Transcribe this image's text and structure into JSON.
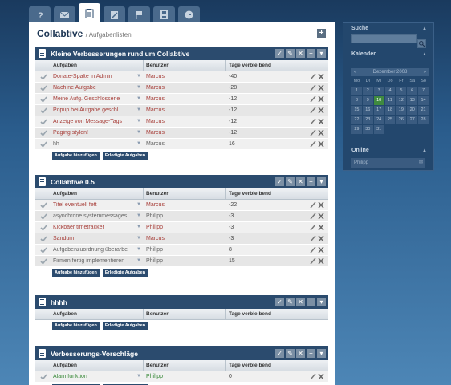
{
  "nav": {
    "tabs": [
      {
        "name": "help-tab",
        "icon": "question-icon"
      },
      {
        "name": "mail-tab",
        "icon": "envelope-icon"
      },
      {
        "name": "tasks-tab",
        "icon": "clipboard-icon",
        "active": true
      },
      {
        "name": "edit-tab",
        "icon": "pencil-icon"
      },
      {
        "name": "flag-tab",
        "icon": "flag-icon"
      },
      {
        "name": "files-tab",
        "icon": "disk-icon"
      },
      {
        "name": "clock-tab",
        "icon": "clock-icon"
      }
    ]
  },
  "page": {
    "title": "Collabtive",
    "subtitle": "/ Aufgabenlisten"
  },
  "columns": {
    "task": "Aufgaben",
    "user": "Benutzer",
    "days": "Tage verbleibend"
  },
  "buttons": {
    "add_task": "Aufgabe hinzufügen",
    "done_tasks": "Erledigte Aufgaben"
  },
  "lists": [
    {
      "title": "Kleine Verbesserungen rund um Collabtive",
      "rows": [
        {
          "task": "Donate-Spalte in Admin",
          "user": "Marcus",
          "days": "-40",
          "color": "red"
        },
        {
          "task": "Nach ne Aufgabe",
          "user": "Marcus",
          "days": "-28",
          "color": "red"
        },
        {
          "task": "Meine Aufg. Geschlossene",
          "user": "Marcus",
          "days": "-12",
          "color": "red"
        },
        {
          "task": "Popup bei Aufgabe geschl",
          "user": "Marcus",
          "days": "-12",
          "color": "red"
        },
        {
          "task": "Anzeige von Message-Tags",
          "user": "Marcus",
          "days": "-12",
          "color": "red"
        },
        {
          "task": "Paging stylen!",
          "user": "Marcus",
          "days": "-12",
          "color": "red"
        },
        {
          "task": "hh",
          "user": "Marcus",
          "days": "16",
          "color": "gray"
        }
      ]
    },
    {
      "title": "Collabtive 0.5",
      "rows": [
        {
          "task": "Titel eventuell fett",
          "user": "Marcus",
          "days": "-22",
          "color": "red"
        },
        {
          "task": "asynchrone systemmessages",
          "user": "Philipp",
          "days": "-3",
          "color": "gray"
        },
        {
          "task": "Kickbaer timetracker",
          "user": "Philipp",
          "days": "-3",
          "color": "red"
        },
        {
          "task": "Sandum",
          "user": "Marcus",
          "days": "-3",
          "color": "red"
        },
        {
          "task": "Aufgabenzuordnung überarbe",
          "user": "Philipp",
          "days": "8",
          "color": "gray"
        },
        {
          "task": "Firmen fertig implementieren",
          "user": "Philipp",
          "days": "15",
          "color": "gray"
        }
      ]
    },
    {
      "title": "hhhh",
      "rows": []
    },
    {
      "title": "Verbesserungs-Vorschläge",
      "rows": [
        {
          "task": "Alarmfunktion",
          "user": "Philipp",
          "days": "0",
          "color": "green"
        }
      ]
    }
  ],
  "sidebar": {
    "search_title": "Suche",
    "calendar_title": "Kalender",
    "calendar_month": "Dezember 2008",
    "weekdays": [
      "Mo",
      "Di",
      "Mi",
      "Do",
      "Fr",
      "Sa",
      "So"
    ],
    "days": [
      "1",
      "2",
      "3",
      "4",
      "5",
      "6",
      "7",
      "8",
      "9",
      "10",
      "11",
      "12",
      "13",
      "14",
      "15",
      "16",
      "17",
      "18",
      "19",
      "20",
      "21",
      "22",
      "23",
      "24",
      "25",
      "26",
      "27",
      "28",
      "29",
      "30",
      "31"
    ],
    "today": "10",
    "online_title": "Online",
    "online_users": [
      "Philipp"
    ]
  }
}
